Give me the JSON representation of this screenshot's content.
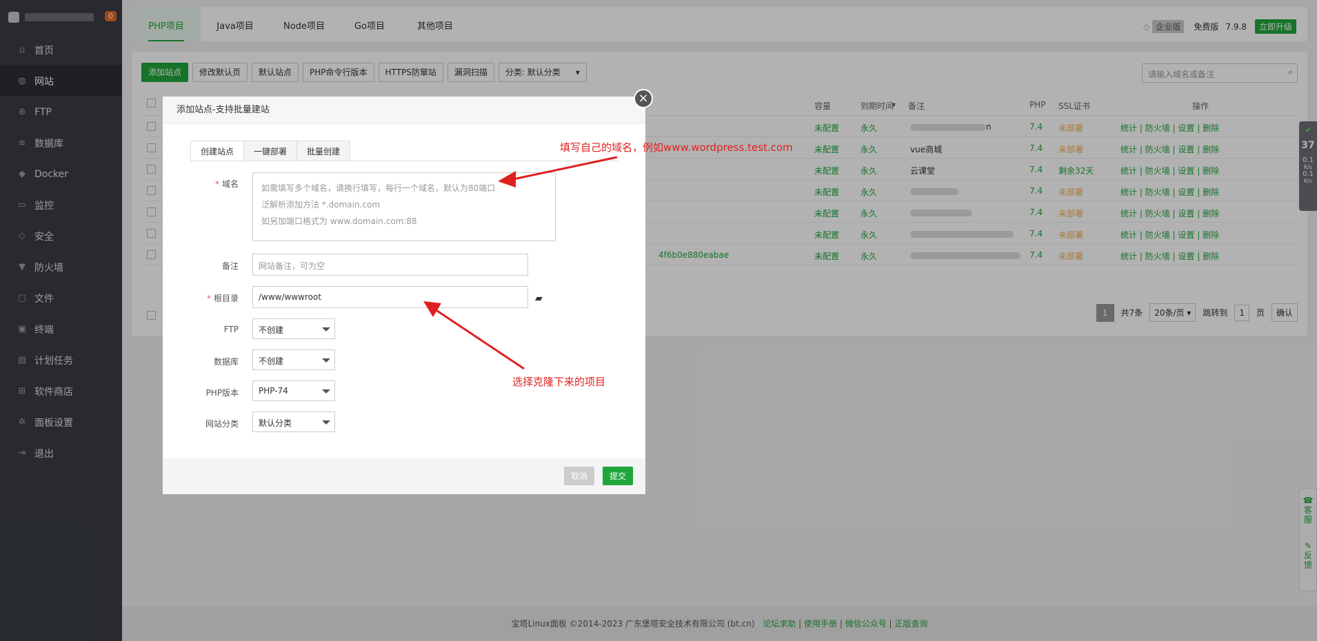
{
  "sidebar": {
    "badge": "0",
    "items": [
      {
        "label": "首页",
        "icon": "home-icon"
      },
      {
        "label": "网站",
        "icon": "globe-icon"
      },
      {
        "label": "FTP",
        "icon": "ftp-icon"
      },
      {
        "label": "数据库",
        "icon": "database-icon"
      },
      {
        "label": "Docker",
        "icon": "docker-icon"
      },
      {
        "label": "监控",
        "icon": "monitor-icon"
      },
      {
        "label": "安全",
        "icon": "shield-icon"
      },
      {
        "label": "防火墙",
        "icon": "firewall-icon"
      },
      {
        "label": "文件",
        "icon": "folder-icon"
      },
      {
        "label": "终端",
        "icon": "terminal-icon"
      },
      {
        "label": "计划任务",
        "icon": "calendar-icon"
      },
      {
        "label": "软件商店",
        "icon": "apps-icon"
      },
      {
        "label": "面板设置",
        "icon": "gear-icon"
      },
      {
        "label": "退出",
        "icon": "logout-icon"
      }
    ]
  },
  "topbar": {
    "tabs": [
      "PHP项目",
      "Java项目",
      "Node项目",
      "Go项目",
      "其他项目"
    ],
    "enterprise": "企业版",
    "free": "免费版",
    "version": "7.9.8",
    "upgrade": "立即升级"
  },
  "toolbar": {
    "add_site": "添加站点",
    "modify_default": "修改默认页",
    "default_site": "默认站点",
    "php_cli": "PHP命令行版本",
    "https_guard": "HTTPS防窜站",
    "vuln_scan": "漏洞扫描",
    "category": "分类: 默认分类"
  },
  "search": {
    "placeholder": "请输入域名或备注"
  },
  "table": {
    "headers": {
      "capacity": "容量",
      "expire": "到期时间",
      "remark": "备注",
      "php": "PHP",
      "ssl": "SSL证书",
      "ops": "操作"
    },
    "rows": [
      {
        "capacity": "未配置",
        "expire": "永久",
        "remark": "n",
        "php": "7.4",
        "ssl": "未部署"
      },
      {
        "capacity": "未配置",
        "expire": "永久",
        "remark": "vue商城",
        "php": "7.4",
        "ssl": "未部署"
      },
      {
        "capacity": "未配置",
        "expire": "永久",
        "remark": "云课堂",
        "php": "7.4",
        "ssl": "剩余32天"
      },
      {
        "capacity": "未配置",
        "expire": "永久",
        "remark": "",
        "php": "7.4",
        "ssl": "未部署"
      },
      {
        "capacity": "未配置",
        "expire": "永久",
        "remark": "",
        "php": "7.4",
        "ssl": "未部署"
      },
      {
        "capacity": "未配置",
        "expire": "永久",
        "remark": "",
        "php": "7.4",
        "ssl": "未部署"
      },
      {
        "capacity": "未配置",
        "expire": "永久",
        "remark": "",
        "php": "7.4",
        "ssl": "未部署"
      }
    ],
    "row_link_fragment": "4f6b0e880eabae",
    "ops": {
      "stats": "统计",
      "firewall": "防火墙",
      "settings": "设置",
      "delete": "删除"
    }
  },
  "pager": {
    "current": "1",
    "total": "共7条",
    "per_page": "20条/页",
    "jump": "跳转到",
    "page_input": "1",
    "page_unit": "页",
    "confirm": "确认"
  },
  "dialog": {
    "title": "添加站点-支持批量建站",
    "tabs": [
      "创建站点",
      "一键部署",
      "批量创建"
    ],
    "domain_label": "域名",
    "domain_hints": [
      "如需填写多个域名，请换行填写，每行一个域名，默认为80端口",
      "泛解析添加方法 *.domain.com",
      "如另加端口格式为 www.domain.com:88"
    ],
    "remark_label": "备注",
    "remark_placeholder": "网站备注，可为空",
    "root_label": "根目录",
    "root_value": "/www/wwwroot",
    "ftp_label": "FTP",
    "ftp_value": "不创建",
    "db_label": "数据库",
    "db_value": "不创建",
    "php_label": "PHP版本",
    "php_value": "PHP-74",
    "cat_label": "网站分类",
    "cat_value": "默认分类",
    "cancel": "取消",
    "submit": "提交"
  },
  "annotations": {
    "domain_note": "填写自己的域名，例如www.wordpress.test.com",
    "root_note": "选择克隆下来的项目"
  },
  "side_status": {
    "percent": "37",
    "up": "0.1",
    "down": "0.1",
    "unit": "K/s"
  },
  "side_help": {
    "service": "客服",
    "feedback": "反馈"
  },
  "footer": {
    "copyright": "宝塔Linux面板 ©2014-2023 广东堡塔安全技术有限公司 (bt.cn)",
    "links": [
      "论坛求助",
      "使用手册",
      "微信公众号",
      "正版查询"
    ]
  },
  "colors": {
    "accent": "#20a53a",
    "sidebar": "#3a3d44",
    "annotation": "#e02020",
    "warning": "#f0ad4e"
  }
}
